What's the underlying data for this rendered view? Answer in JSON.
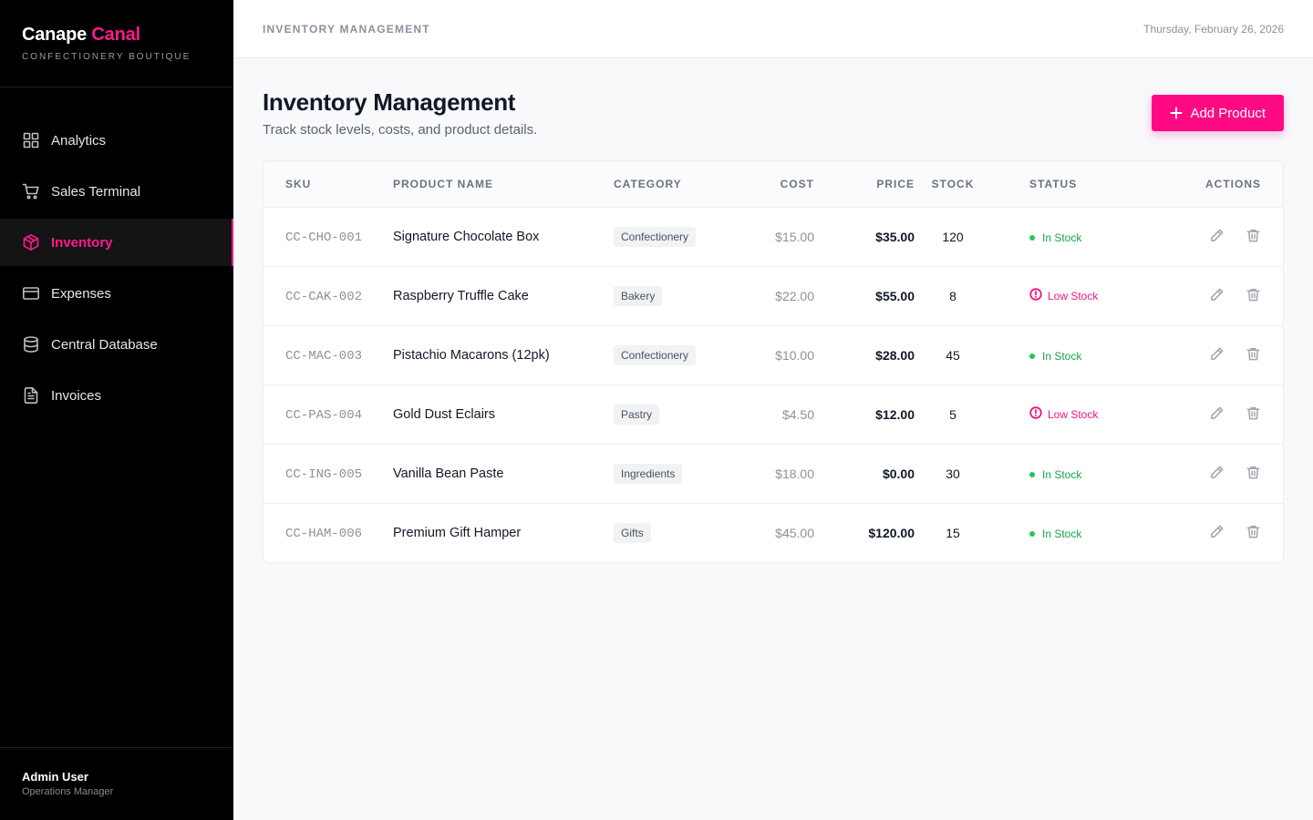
{
  "brand": {
    "name_main": "Canape",
    "name_accent": "Canal",
    "subtitle": "CONFECTIONERY BOUTIQUE",
    "accent_color": "#ff1a8c"
  },
  "sidebar": {
    "items": [
      {
        "label": "Analytics",
        "icon": "grid-icon",
        "active": false
      },
      {
        "label": "Sales Terminal",
        "icon": "cart-icon",
        "active": false
      },
      {
        "label": "Inventory",
        "icon": "package-icon",
        "active": true
      },
      {
        "label": "Expenses",
        "icon": "credit-card-icon",
        "active": false
      },
      {
        "label": "Central Database",
        "icon": "database-icon",
        "active": false
      },
      {
        "label": "Invoices",
        "icon": "document-icon",
        "active": false
      }
    ],
    "user": {
      "name": "Admin User",
      "role": "Operations Manager"
    }
  },
  "topbar": {
    "section": "INVENTORY MANAGEMENT",
    "date": "Thursday, February 26, 2026"
  },
  "page": {
    "title": "Inventory Management",
    "subtitle": "Track stock levels, costs, and product details.",
    "add_button": "Add Product"
  },
  "table": {
    "headers": [
      "SKU",
      "PRODUCT NAME",
      "CATEGORY",
      "COST",
      "PRICE",
      "STOCK",
      "STATUS",
      "ACTIONS"
    ],
    "rows": [
      {
        "sku": "CC-CHO-001",
        "name": "Signature Chocolate Box",
        "category": "Confectionery",
        "cost": "$15.00",
        "price": "$35.00",
        "stock": "120",
        "status": "In Stock",
        "status_type": "ok"
      },
      {
        "sku": "CC-CAK-002",
        "name": "Raspberry Truffle Cake",
        "category": "Bakery",
        "cost": "$22.00",
        "price": "$55.00",
        "stock": "8",
        "status": "Low Stock",
        "status_type": "low"
      },
      {
        "sku": "CC-MAC-003",
        "name": "Pistachio Macarons (12pk)",
        "category": "Confectionery",
        "cost": "$10.00",
        "price": "$28.00",
        "stock": "45",
        "status": "In Stock",
        "status_type": "ok"
      },
      {
        "sku": "CC-PAS-004",
        "name": "Gold Dust Eclairs",
        "category": "Pastry",
        "cost": "$4.50",
        "price": "$12.00",
        "stock": "5",
        "status": "Low Stock",
        "status_type": "low"
      },
      {
        "sku": "CC-ING-005",
        "name": "Vanilla Bean Paste",
        "category": "Ingredients",
        "cost": "$18.00",
        "price": "$0.00",
        "stock": "30",
        "status": "In Stock",
        "status_type": "ok"
      },
      {
        "sku": "CC-HAM-006",
        "name": "Premium Gift Hamper",
        "category": "Gifts",
        "cost": "$45.00",
        "price": "$120.00",
        "stock": "15",
        "status": "In Stock",
        "status_type": "ok"
      }
    ]
  }
}
